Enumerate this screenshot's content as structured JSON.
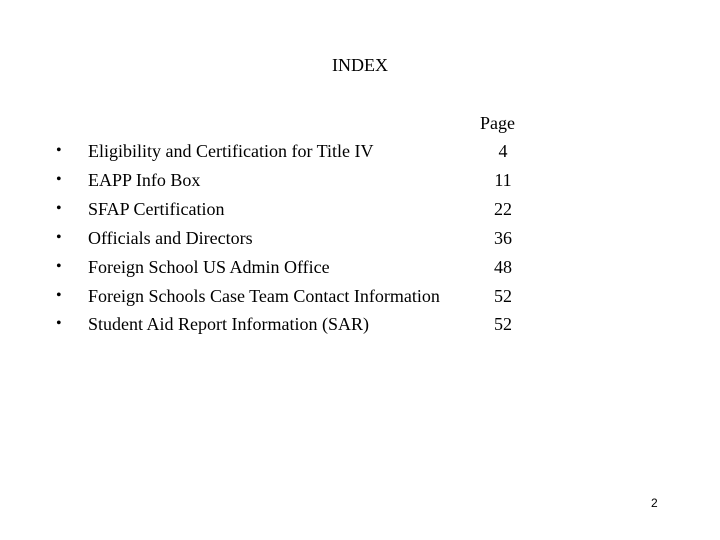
{
  "document": {
    "title": "INDEX",
    "page_column_header": "Page",
    "bullet_glyph": "•",
    "entries": [
      {
        "label": "Eligibility and Certification for Title IV",
        "page": "4"
      },
      {
        "label": "EAPP Info Box",
        "page": "11"
      },
      {
        "label": "SFAP Certification",
        "page": "22"
      },
      {
        "label": "Officials and Directors",
        "page": "36"
      },
      {
        "label": "Foreign School US Admin Office",
        "page": "48"
      },
      {
        "label": "Foreign Schools Case Team Contact Information",
        "page": "52"
      },
      {
        "label": "Student Aid Report Information (SAR)",
        "page": "52"
      }
    ],
    "footer_page_number": "2"
  }
}
